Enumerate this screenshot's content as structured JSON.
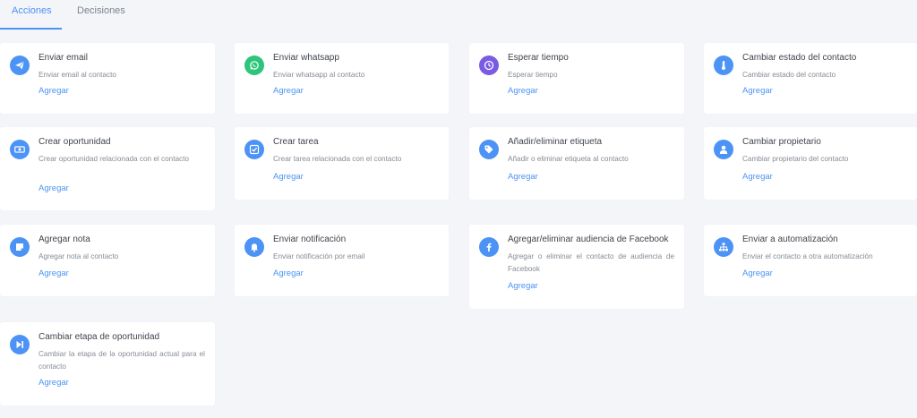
{
  "tabs": {
    "acciones": "Acciones",
    "decisiones": "Decisiones"
  },
  "colors": {
    "accent": "#4c93f5",
    "whatsapp": "#2ec57a",
    "timer": "#7a5be3",
    "background": "#f3f5f8"
  },
  "cards": [
    {
      "title": "Enviar email",
      "desc": "Enviar email al contacto",
      "action": "Agregar",
      "icon": "paper-plane-icon"
    },
    {
      "title": "Enviar whatsapp",
      "desc": "Enviar whatsapp al contacto",
      "action": "Agregar",
      "icon": "whatsapp-icon"
    },
    {
      "title": "Esperar tiempo",
      "desc": "Esperar tiempo",
      "action": "Agregar",
      "icon": "clock-icon"
    },
    {
      "title": "Cambiar estado del contacto",
      "desc": "Cambiar estado del contacto",
      "action": "Agregar",
      "icon": "thermometer-icon"
    },
    {
      "title": "Crear oportunidad",
      "desc": "Crear oportunidad relacionada con el contacto",
      "action": "Agregar",
      "icon": "money-icon"
    },
    {
      "title": "Crear tarea",
      "desc": "Crear tarea relacionada con el contacto",
      "action": "Agregar",
      "icon": "check-square-icon"
    },
    {
      "title": "Añadir/eliminar etiqueta",
      "desc": "Añadir o eliminar etiqueta al contacto",
      "action": "Agregar",
      "icon": "tag-icon"
    },
    {
      "title": "Cambiar propietario",
      "desc": "Cambiar propietario del contacto",
      "action": "Agregar",
      "icon": "user-icon"
    },
    {
      "title": "Agregar nota",
      "desc": "Agregar nota al contacto",
      "action": "Agregar",
      "icon": "note-icon"
    },
    {
      "title": "Enviar notificación",
      "desc": "Enviar notificación por email",
      "action": "Agregar",
      "icon": "bell-icon"
    },
    {
      "title": "Agregar/eliminar audiencia de Facebook",
      "desc": "Agregar o eliminar el contacto de audiencia de Facebook",
      "action": "Agregar",
      "icon": "facebook-icon"
    },
    {
      "title": "Enviar a automatización",
      "desc": "Enviar el contacto a otra automatización",
      "action": "Agregar",
      "icon": "sitemap-icon"
    },
    {
      "title": "Cambiar etapa de oportunidad",
      "desc": "Cambiar la etapa de la oportunidad actual para el contacto",
      "action": "Agregar",
      "icon": "step-forward-icon"
    }
  ]
}
